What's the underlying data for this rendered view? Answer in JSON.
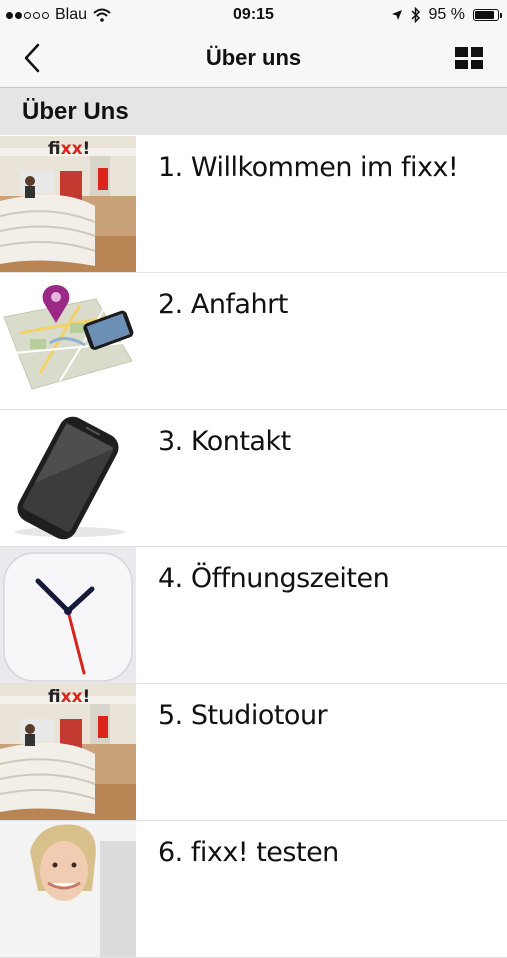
{
  "status_bar": {
    "carrier": "●●○○○ Blau",
    "carrier_name": "Blau",
    "time": "09:15",
    "battery": "95 %",
    "battery_level": 0.95,
    "signal_bars_filled": 2,
    "signal_bars_total": 5
  },
  "nav": {
    "title": "Über uns",
    "back_icon": "chevron-left-icon",
    "menu_icon": "grid-icon"
  },
  "section": {
    "title": "Über Uns"
  },
  "items": [
    {
      "label": "1. Willkommen im fixx!",
      "thumbnail": "reception-photo"
    },
    {
      "label": "2. Anfahrt",
      "thumbnail": "map-pin-icon"
    },
    {
      "label": "3. Kontakt",
      "thumbnail": "smartphone-icon"
    },
    {
      "label": "4. Öffnungszeiten",
      "thumbnail": "clock-icon"
    },
    {
      "label": "5. Studiotour",
      "thumbnail": "reception-photo"
    },
    {
      "label": "6. fixx! testen",
      "thumbnail": "woman-photo"
    }
  ],
  "colors": {
    "bar_bg": "#f7f7f7",
    "section_bg": "#e5e5e5",
    "text": "#111111",
    "brand_red": "#d9261c"
  }
}
